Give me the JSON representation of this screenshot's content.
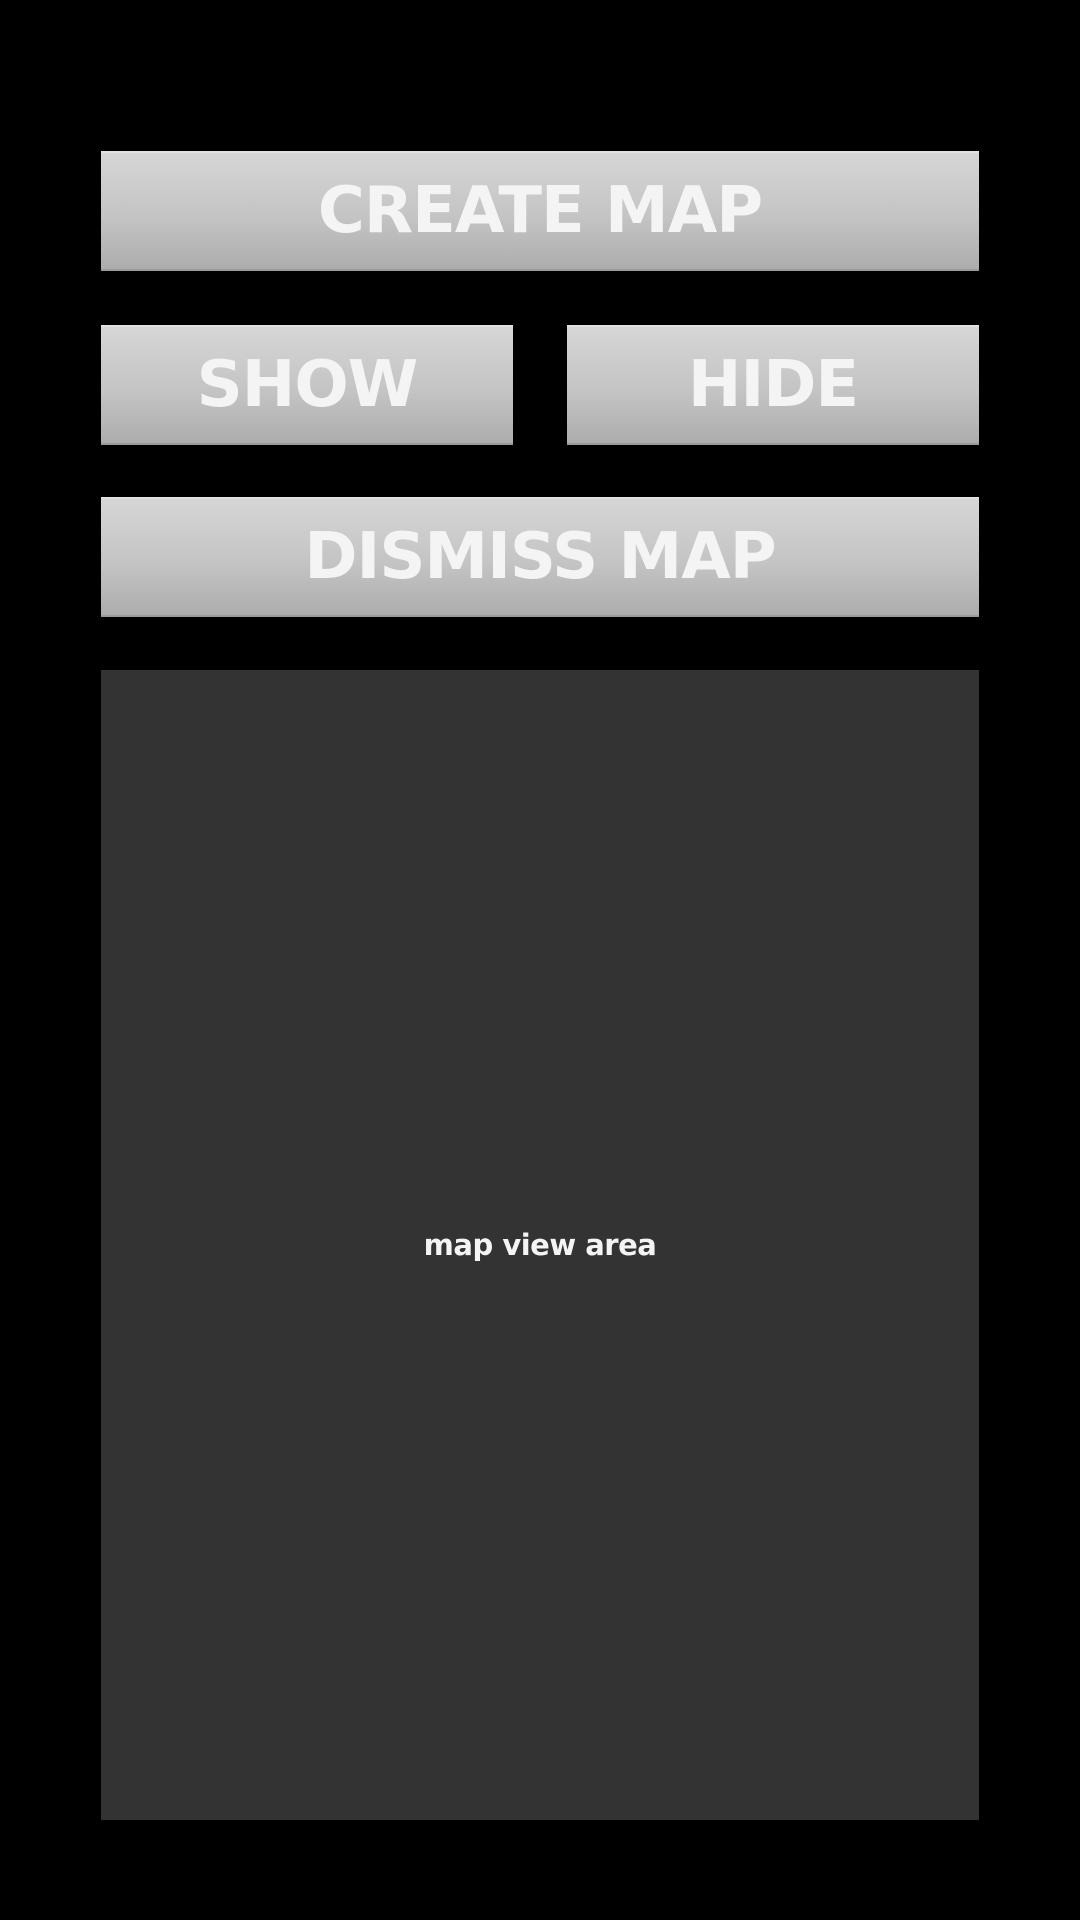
{
  "buttons": {
    "create_map": "CREATE MAP",
    "show": "SHOW",
    "hide": "HIDE",
    "dismiss_map": "DISMISS MAP"
  },
  "map": {
    "placeholder_label": "map view area"
  },
  "colors": {
    "background": "#000000",
    "button_gradient_top": "#d6d6d6",
    "button_gradient_bottom": "#adadad",
    "button_text": "#f4f4f4",
    "map_area": "#333333"
  }
}
